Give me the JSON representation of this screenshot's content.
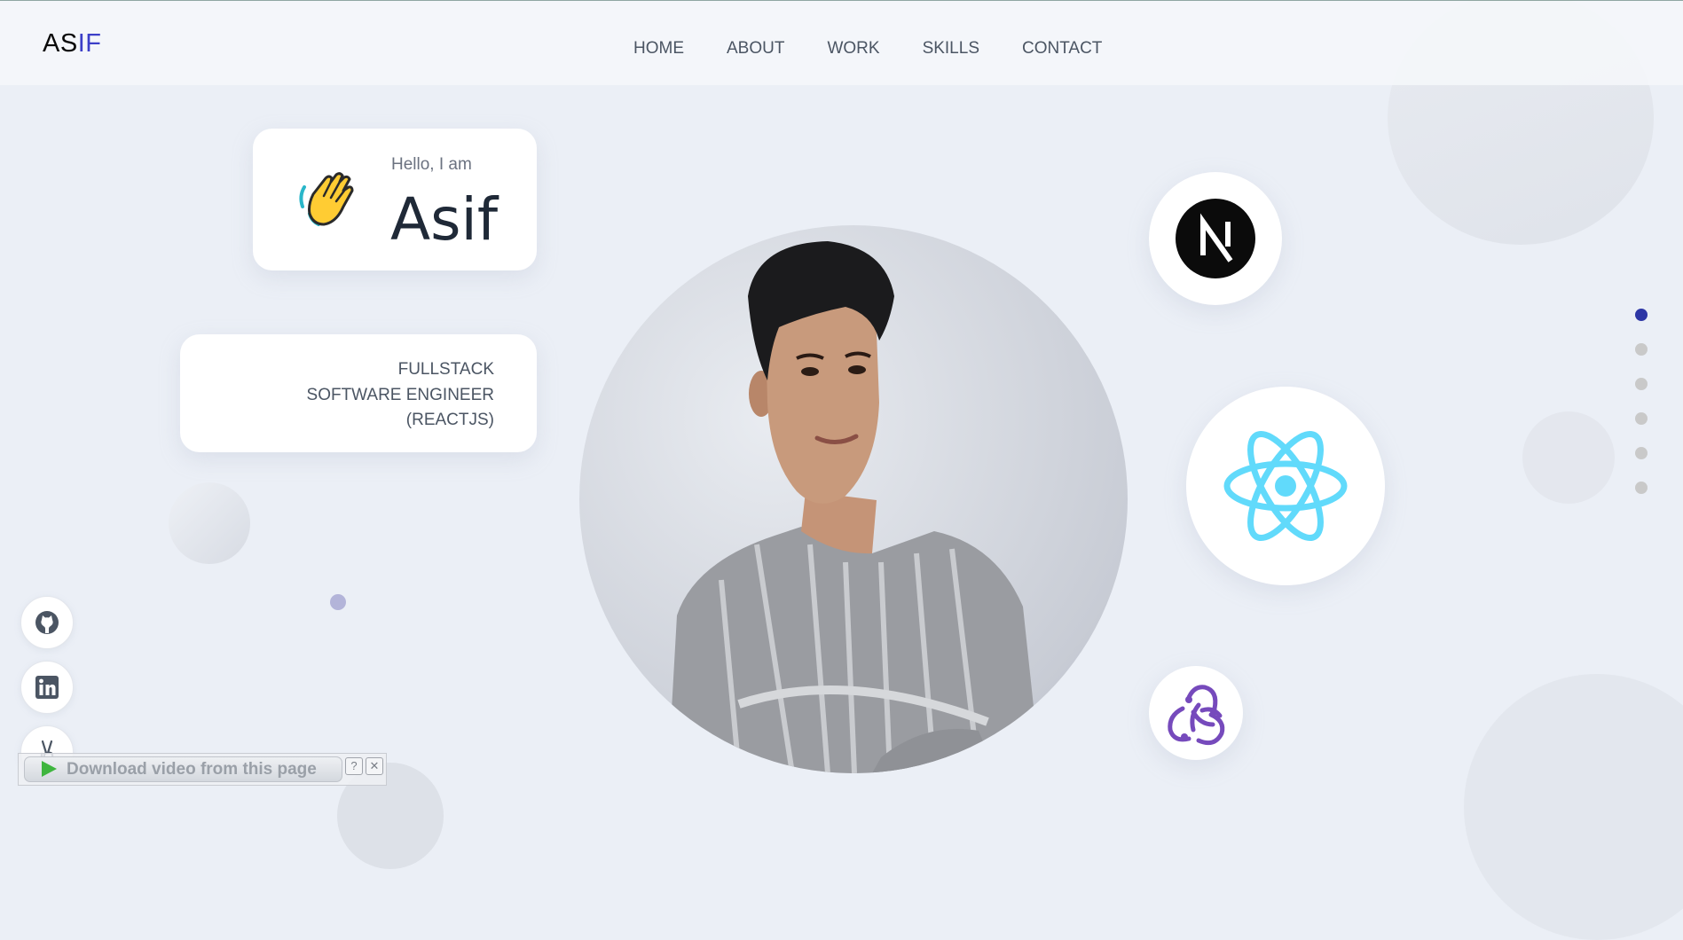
{
  "logo": {
    "part1": "AS",
    "part2": "IF"
  },
  "nav": {
    "items": [
      "HOME",
      "ABOUT",
      "WORK",
      "SKILLS",
      "CONTACT"
    ]
  },
  "hero": {
    "greeting": "Hello, I am",
    "name": "Asif",
    "role_lines": [
      "FULLSTACK",
      "SOFTWARE ENGINEER",
      "(REACTJS)"
    ],
    "hand_icon": "waving-hand-icon"
  },
  "tech_badges": [
    "nextjs-icon",
    "react-icon",
    "redux-icon"
  ],
  "section_dots": {
    "count": 6,
    "active_index": 0
  },
  "social_links": [
    "github-icon",
    "linkedin-icon",
    "angellist-icon"
  ],
  "download_bar": {
    "label": "Download video from this page",
    "help": "?",
    "close": "✕"
  },
  "colors": {
    "background": "#ebeff6",
    "logo_accent": "#3c3fc8",
    "active_dot": "#2d36a5",
    "react": "#61dafb",
    "redux": "#764abc"
  }
}
